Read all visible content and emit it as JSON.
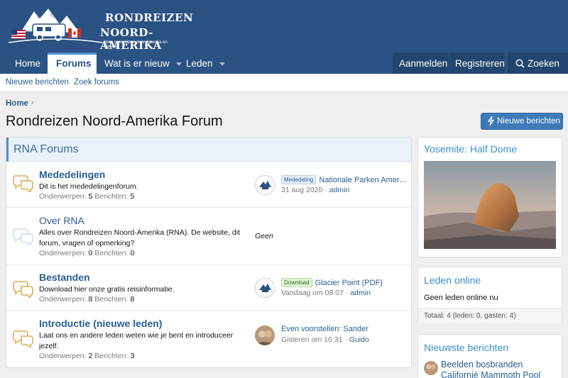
{
  "header": {
    "logo_line1": "RONDREIZEN",
    "logo_line2": "NOORD-AMERIKA",
    "logo_tagline": "Alles over reizen door Amerika en Canada",
    "brand_color": "#2a5283"
  },
  "nav": {
    "items": [
      {
        "label": "Home"
      },
      {
        "label": "Forums"
      },
      {
        "label": "Wat is er nieuw"
      },
      {
        "label": "Leden"
      }
    ],
    "login": "Aanmelden",
    "register": "Registreren",
    "search": "Zoeken"
  },
  "subnav": {
    "new_posts": "Nieuwe berichten",
    "search_forums": "Zoek forums"
  },
  "breadcrumb": {
    "home": "Home"
  },
  "page": {
    "title": "Rondreizen Noord-Amerika Forum",
    "new_posts_button": "Nieuwe berichten"
  },
  "forums": {
    "heading": "RNA Forums",
    "stats_topics_label": "Onderwerpen:",
    "stats_posts_label": "Berichten:",
    "rows": [
      {
        "name": "Mededelingen",
        "desc": "Dit is het mededelingenforum.",
        "topics": "5",
        "posts": "5",
        "badge": "Mededeling",
        "last_title": "Nationale Parken Amer…",
        "last_date": "31 aug 2020",
        "last_user": "admin"
      },
      {
        "name": "Over RNA",
        "desc": "Alles over Rondreizen Noord-Amerika (RNA). De website, dit forum, vragen of opmerking?",
        "topics": "0",
        "posts": "0",
        "none": "Geen"
      },
      {
        "name": "Bestanden",
        "desc": "Download hier onze gratis reisinformatie.",
        "topics": "8",
        "posts": "8",
        "badge": "Download",
        "last_title": "Glacier Point (PDF)",
        "last_date": "Vandaag om 08:07",
        "last_user": "admin"
      },
      {
        "name": "Introductie (nieuwe leden)",
        "desc": "Laat ons en andere leden weten wie je bent en introduceer jezelf.",
        "topics": "2",
        "posts": "3",
        "last_title": "Even voorstellen: Sander",
        "last_date": "Gisteren om 16:31",
        "last_user": "Guido"
      }
    ]
  },
  "sidebar": {
    "photo_title": "Yosemite: Half Dome",
    "online_title": "Leden online",
    "online_text": "Geen leden online nu",
    "online_total": "Totaal: 4 (leden: 0, gasten: 4)",
    "latest_title": "Nieuwste berichten",
    "latest_item_line1": "Beelden bosbranden",
    "latest_item_line2": "Californië Mammoth Pool"
  }
}
